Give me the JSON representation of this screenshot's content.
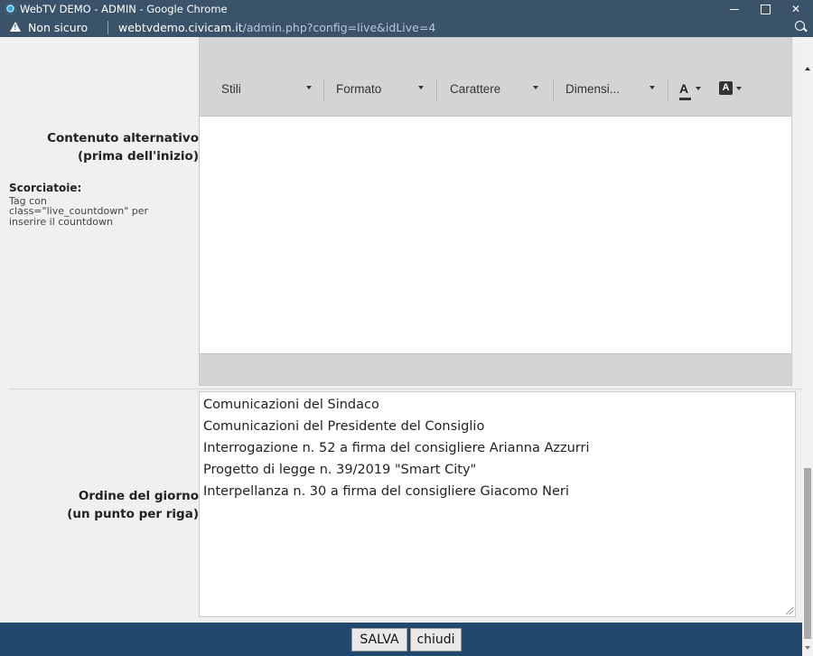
{
  "window": {
    "title": "WebTV DEMO - ADMIN - Google Chrome"
  },
  "addressbar": {
    "security_label": "Non sicuro",
    "url_host": "webtvdemo.civicam.it",
    "url_path": "/admin.php?config=live&idLive=4"
  },
  "form": {
    "alt_content": {
      "label_line1": "Contenuto alternativo",
      "label_line2": "(prima dell'inizio)",
      "shortcuts_title": "Scorciatoie:",
      "shortcuts_line1": "Tag con",
      "shortcuts_line2": "class=\"live_countdown\" per",
      "shortcuts_line3": "inserire il countdown"
    },
    "editor_toolbar": {
      "styles": "Stili",
      "format": "Formato",
      "font": "Carattere",
      "size": "Dimensi...",
      "text_color_glyph": "A",
      "bg_color_glyph": "A"
    },
    "agenda": {
      "label_line1": "Ordine del giorno",
      "label_line2": "(un punto per riga)",
      "lines": [
        "Comunicazioni del Sindaco",
        "Comunicazioni del Presidente del Consiglio",
        "Interrogazione n. 52 a firma del consigliere Arianna Azzurri",
        "Progetto di legge n. 39/2019 \"Smart City\"",
        "Interpellanza n. 30 a firma del consigliere Giacomo Neri"
      ]
    }
  },
  "footer": {
    "save_label": "SALVA",
    "close_label": "chiudi"
  },
  "colors": {
    "chrome_bar": "#3a536b",
    "footer_bar": "#22496d",
    "panel_bg": "#f0f0f0",
    "toolbar_bg": "#d4d4d4"
  }
}
